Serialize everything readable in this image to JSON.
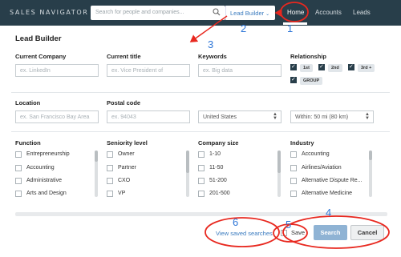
{
  "topbar": {
    "brand": "SALES NAVIGATOR",
    "search_placeholder": "Search for people and companies...",
    "lead_builder": "Lead Builder",
    "nav": {
      "home": "Home",
      "accounts": "Accounts",
      "leads": "Leads"
    }
  },
  "page_title": "Lead Builder",
  "row1": {
    "current_company": {
      "label": "Current Company",
      "placeholder": "ex. LinkedIn"
    },
    "current_title": {
      "label": "Current title",
      "placeholder": "ex. Vice President of"
    },
    "keywords": {
      "label": "Keywords",
      "placeholder": "ex. Big data"
    },
    "relationship": {
      "label": "Relationship",
      "options": [
        "1st",
        "2nd",
        "3rd +",
        "GROUP"
      ]
    }
  },
  "row2": {
    "location": {
      "label": "Location",
      "placeholder": "ex. San Francisco Bay Area"
    },
    "postal_code": {
      "label": "Postal code",
      "placeholder": "ex. 94043"
    },
    "country": "United States",
    "radius": "Within: 50 mi (80 km)"
  },
  "filters": {
    "function": {
      "label": "Function",
      "items": [
        "Entrepreneurship",
        "Accounting",
        "Administrative",
        "Arts and Design"
      ]
    },
    "seniority": {
      "label": "Seniority level",
      "items": [
        "Owner",
        "Partner",
        "CXO",
        "VP"
      ]
    },
    "company_size": {
      "label": "Company size",
      "items": [
        "1-10",
        "11-50",
        "51-200",
        "201-500"
      ]
    },
    "industry": {
      "label": "Industry",
      "items": [
        "Accounting",
        "Airlines/Aviation",
        "Alternative Dispute Re...",
        "Alternative Medicine"
      ]
    }
  },
  "footer": {
    "view_saved": "View saved searches",
    "save": "Save",
    "search": "Search",
    "cancel": "Cancel"
  },
  "annotations": [
    "1",
    "2",
    "3",
    "4",
    "5",
    "6"
  ],
  "colors": {
    "topbar": "#283e4a",
    "link": "#3a7bbf",
    "annotation_red": "#e8281f",
    "annotation_blue": "#2f77d8"
  }
}
